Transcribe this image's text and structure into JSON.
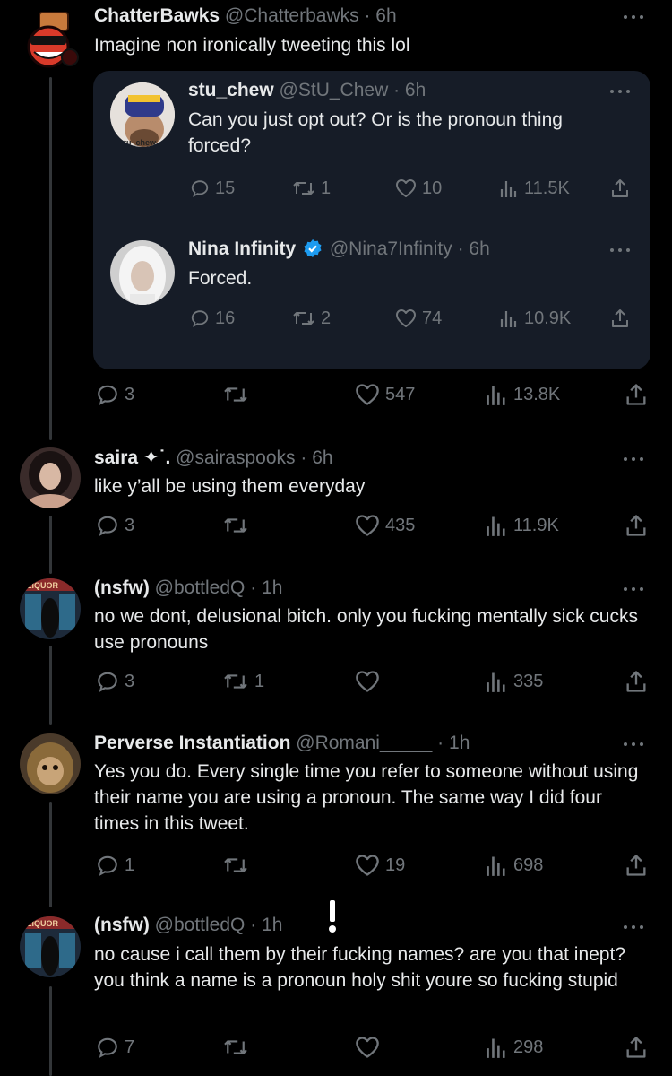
{
  "tweets": {
    "main": {
      "name": "ChatterBawks",
      "handle": "@Chatterbawks",
      "sep": " · ",
      "time": "6h",
      "text": "Imagine non ironically tweeting this lol",
      "replies": "3",
      "retweets": "",
      "likes": "547",
      "views": "13.8K"
    },
    "quote1": {
      "name": "stu_chew",
      "handle": "@StU_Chew",
      "sep": " · ",
      "time": "6h",
      "avatar_caption": "stu_chew",
      "text": "Can you just opt out? Or is the pronoun thing forced?",
      "replies": "15",
      "retweets": "1",
      "likes": "10",
      "views": "11.5K"
    },
    "quote2": {
      "name": "Nina Infinity",
      "handle": "@Nina7Infinity",
      "sep": " · ",
      "time": "6h",
      "verified": true,
      "text": "Forced.",
      "replies": "16",
      "retweets": "2",
      "likes": "74",
      "views": "10.9K"
    },
    "reply1": {
      "name": "saira ✦˙.",
      "handle": "@sairaspooks",
      "sep": " · ",
      "time": "6h",
      "text": "like y’all be using them everyday",
      "replies": "3",
      "retweets": "",
      "likes": "435",
      "views": "11.9K"
    },
    "reply2": {
      "name": "(nsfw)",
      "handle": "@bottledQ",
      "sep": " · ",
      "time": "1h",
      "avatar_caption": "LIQUOR",
      "text": "no we dont, delusional bitch. only you fucking mentally sick cucks use pronouns",
      "replies": "3",
      "retweets": "1",
      "likes": "",
      "views": "335"
    },
    "reply3": {
      "name": "Perverse Instantiation",
      "handle": "@Romani_____",
      "sep": " · ",
      "time": "1h",
      "text": "Yes you do. Every single time you refer to someone without using their name you are using a pronoun. The same way I did four times in this tweet.",
      "replies": "1",
      "retweets": "",
      "likes": "19",
      "views": "698"
    },
    "reply4": {
      "name": "(nsfw)",
      "handle": "@bottledQ",
      "sep": " · ",
      "time": "1h",
      "avatar_caption": "LIQUOR",
      "text": "no cause i call them by their fucking names? are you that inept? you think a name is a pronoun holy shit youre so fucking stupid",
      "replies": "7",
      "retweets": "",
      "likes": "",
      "views": "298"
    }
  },
  "icons": {
    "reply": "reply-icon",
    "retweet": "retweet-icon",
    "like": "like-icon",
    "views": "views-icon",
    "share": "share-icon",
    "more": "more-icon",
    "verified": "verified-badge-icon",
    "alert": "exclamation-icon"
  },
  "colors": {
    "background": "#000000",
    "card": "#161c27",
    "text": "#e7e9ea",
    "muted": "#71767b",
    "verified": "#1d9bf0",
    "thread_line": "#333639"
  }
}
